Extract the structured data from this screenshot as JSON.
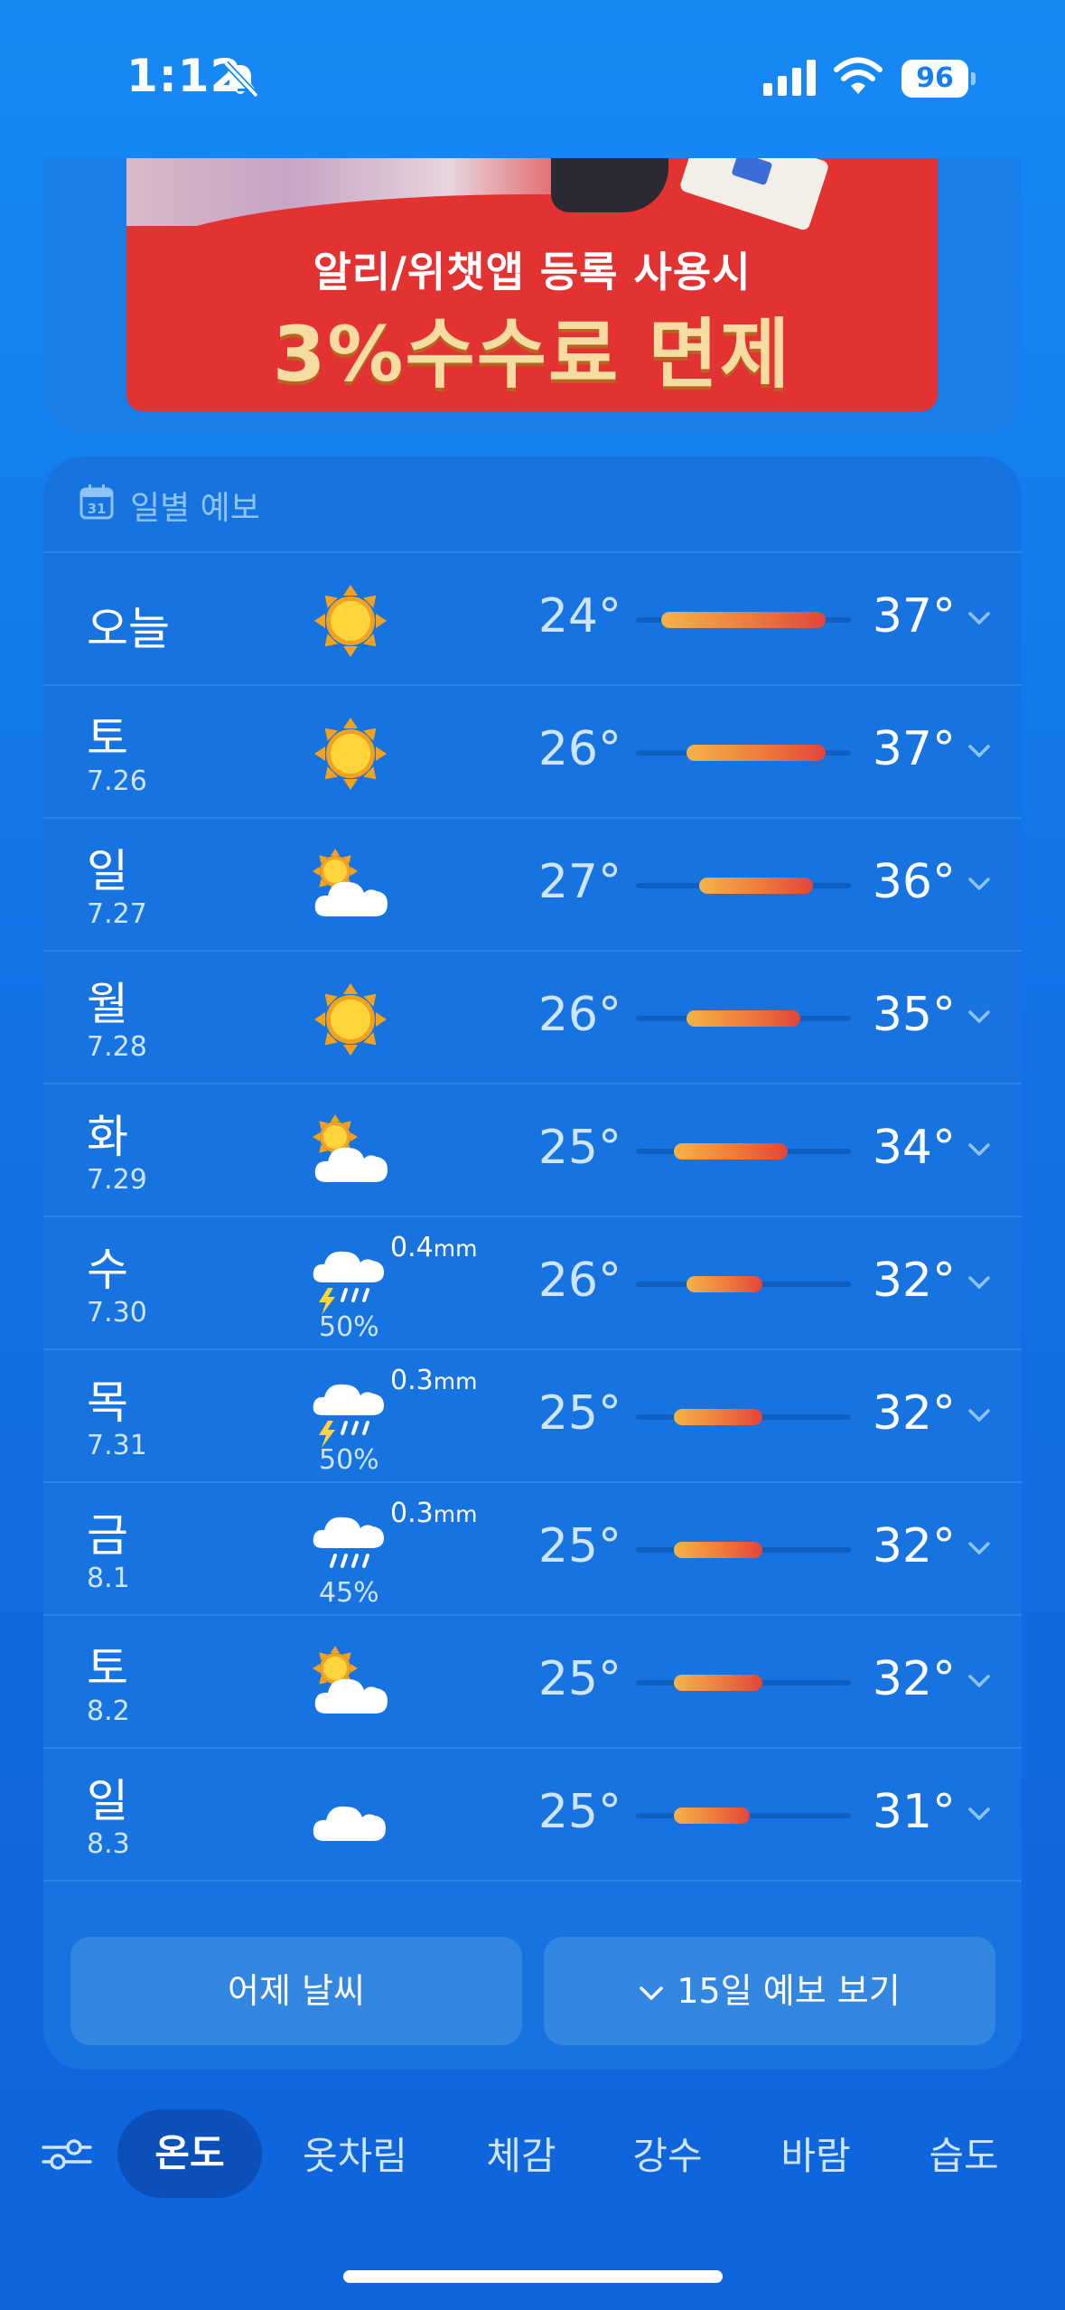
{
  "status": {
    "time": "1:12",
    "battery": "96"
  },
  "ad": {
    "line1": "알리/위챗앱 등록 사용시",
    "line2": "3%수수료 면제"
  },
  "forecast": {
    "header_title": "일별 예보",
    "calendar_day": "31",
    "rows": [
      {
        "day": "오늘",
        "date": "",
        "icon": "sun-icon",
        "min": "24°",
        "max": "37°",
        "precip_amount": "",
        "precip_unit": "",
        "precip_prob": ""
      },
      {
        "day": "토",
        "date": "7.26",
        "icon": "sun-icon",
        "min": "26°",
        "max": "37°",
        "precip_amount": "",
        "precip_unit": "",
        "precip_prob": ""
      },
      {
        "day": "일",
        "date": "7.27",
        "icon": "partly-cloudy-icon",
        "min": "27°",
        "max": "36°",
        "precip_amount": "",
        "precip_unit": "",
        "precip_prob": ""
      },
      {
        "day": "월",
        "date": "7.28",
        "icon": "sun-icon",
        "min": "26°",
        "max": "35°",
        "precip_amount": "",
        "precip_unit": "",
        "precip_prob": ""
      },
      {
        "day": "화",
        "date": "7.29",
        "icon": "partly-cloudy-icon",
        "min": "25°",
        "max": "34°",
        "precip_amount": "",
        "precip_unit": "",
        "precip_prob": ""
      },
      {
        "day": "수",
        "date": "7.30",
        "icon": "thunderstorm-icon",
        "min": "26°",
        "max": "32°",
        "precip_amount": "0.4",
        "precip_unit": "mm",
        "precip_prob": "50%"
      },
      {
        "day": "목",
        "date": "7.31",
        "icon": "thunderstorm-icon",
        "min": "25°",
        "max": "32°",
        "precip_amount": "0.3",
        "precip_unit": "mm",
        "precip_prob": "50%"
      },
      {
        "day": "금",
        "date": "8.1",
        "icon": "rain-icon",
        "min": "25°",
        "max": "32°",
        "precip_amount": "0.3",
        "precip_unit": "mm",
        "precip_prob": "45%"
      },
      {
        "day": "토",
        "date": "8.2",
        "icon": "partly-cloudy-icon",
        "min": "25°",
        "max": "32°",
        "precip_amount": "",
        "precip_unit": "",
        "precip_prob": ""
      },
      {
        "day": "일",
        "date": "8.3",
        "icon": "cloud-icon",
        "min": "25°",
        "max": "31°",
        "precip_amount": "",
        "precip_unit": "",
        "precip_prob": ""
      }
    ],
    "yesterday_button": "어제 날씨",
    "fifteen_day_button": "15일 예보 보기"
  },
  "tabs": {
    "active": "온도",
    "items": [
      "온도",
      "옷차림",
      "체감",
      "강수",
      "바람",
      "습도"
    ]
  },
  "colors": {
    "background_top": "#1689f5",
    "card": "#1673e0",
    "bar_start": "#f5b347",
    "bar_end": "#e2453a",
    "tab_active": "#0b4fb8"
  }
}
